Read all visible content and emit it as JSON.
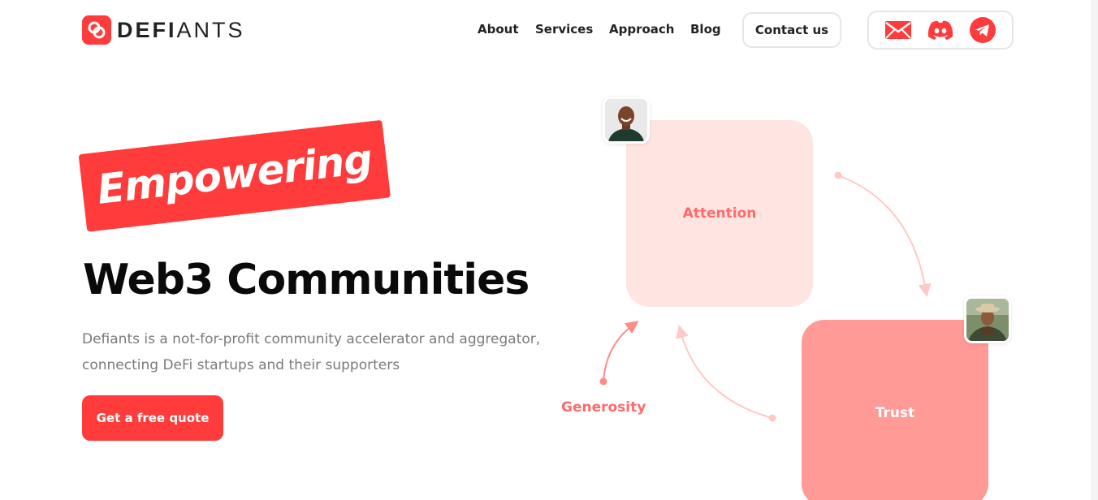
{
  "brand": {
    "name_bold": "DEFI",
    "name_light": "ANTS",
    "accent": "#ff3b3b"
  },
  "nav": {
    "items": [
      {
        "label": "About"
      },
      {
        "label": "Services"
      },
      {
        "label": "Approach"
      },
      {
        "label": "Blog"
      }
    ],
    "contact_label": "Contact us",
    "socials": [
      {
        "icon": "mail-icon"
      },
      {
        "icon": "discord-icon"
      },
      {
        "icon": "telegram-icon"
      }
    ]
  },
  "hero": {
    "tag": "Empowering",
    "headline": "Web3 Communities",
    "description": "Defiants is a not-for-profit community accelerator and aggregator, connecting DeFi startups and their supporters",
    "cta_label": "Get a free quote"
  },
  "diagram": {
    "attention": "Attention",
    "trust": "Trust",
    "generosity": "Generosity",
    "colors": {
      "attention_bg": "#ffe5e2",
      "trust_bg": "#ff9a96",
      "label": "#ff6b6b",
      "arrow": "#ffc9c5"
    }
  }
}
